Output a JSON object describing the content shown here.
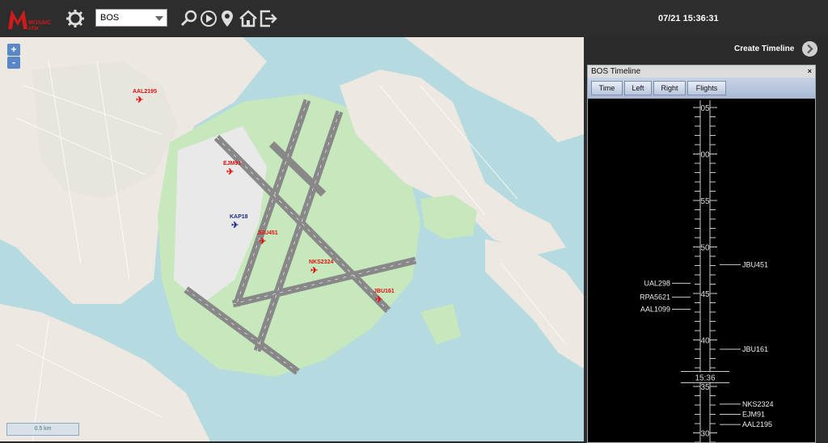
{
  "header": {
    "logo_text": "MOSAIC ATM",
    "icons": [
      "gear-icon",
      "search-icon",
      "play-circle-icon",
      "location-pin-icon",
      "home-icon",
      "logout-icon"
    ],
    "airport_select": "BOS",
    "clock": "07/21 15:36:31"
  },
  "map": {
    "zoom_in": "+",
    "zoom_out": "-",
    "scale_label": "0.5 km",
    "flights": [
      {
        "callsign": "AAL2195",
        "color": "red"
      },
      {
        "callsign": "EJM91",
        "color": "red"
      },
      {
        "callsign": "KAP18",
        "color": "blue"
      },
      {
        "callsign": "JBU451",
        "color": "red"
      },
      {
        "callsign": "NKS2324",
        "color": "red"
      },
      {
        "callsign": "JBU161",
        "color": "red"
      }
    ]
  },
  "right_panel": {
    "create_timeline": "Create Timeline",
    "timeline": {
      "title": "BOS Timeline",
      "close": "×",
      "buttons": [
        "Time",
        "Left",
        "Right",
        "Flights"
      ],
      "current_time": "15:36",
      "minute_labels": [
        "05",
        "00",
        "55",
        "50",
        "45",
        "40",
        "35",
        "30"
      ],
      "left_flights": [
        {
          "callsign": "UAL298",
          "minute": 46.1
        },
        {
          "callsign": "RPA5621",
          "minute": 44.6
        },
        {
          "callsign": "AAL1099",
          "minute": 43.3
        }
      ],
      "right_flights": [
        {
          "callsign": "JBU451",
          "minute": 48.1
        },
        {
          "callsign": "JBU161",
          "minute": 39.0
        },
        {
          "callsign": "NKS2324",
          "minute": 33.1
        },
        {
          "callsign": "EJM91",
          "minute": 32.0
        },
        {
          "callsign": "AAL2195",
          "minute": 30.9
        }
      ]
    }
  },
  "colors": {
    "water": "#b5dae0",
    "land": "#eef0e8",
    "park": "#c7e8bc",
    "runway": "#888888",
    "flight_red": "#e01010",
    "flight_blue": "#1a2a8a"
  }
}
